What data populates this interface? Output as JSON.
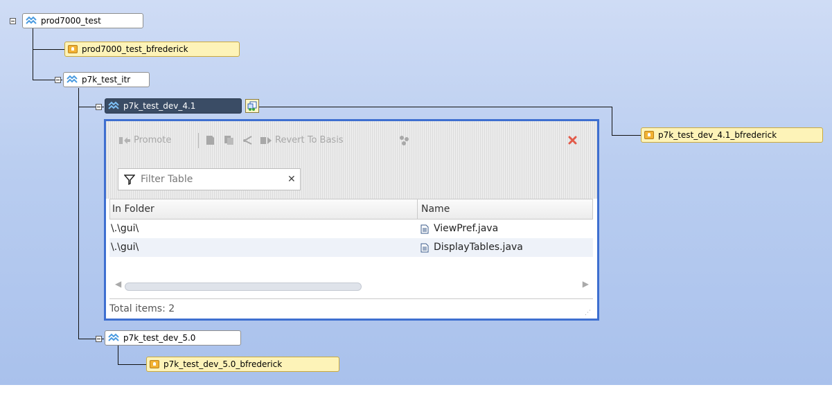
{
  "tree": {
    "root": {
      "label": "prod7000_test"
    },
    "root_workspace": {
      "label": "prod7000_test_bfrederick"
    },
    "itr": {
      "label": "p7k_test_itr"
    },
    "dev41": {
      "label": "p7k_test_dev_4.1"
    },
    "dev41_workspace": {
      "label": "p7k_test_dev_4.1_bfrederick"
    },
    "dev50": {
      "label": "p7k_test_dev_5.0"
    },
    "dev50_workspace": {
      "label": "p7k_test_dev_5.0_bfrederick"
    }
  },
  "panel": {
    "toolbar": {
      "promote_label": "Promote",
      "revert_label": "Revert To Basis"
    },
    "filter": {
      "placeholder": "Filter Table"
    },
    "table": {
      "columns": [
        "In Folder",
        "Name"
      ],
      "rows": [
        {
          "folder": "\\.\\gui\\",
          "name": "ViewPref.java"
        },
        {
          "folder": "\\.\\gui\\",
          "name": "DisplayTables.java"
        }
      ]
    },
    "status": "Total items: 2"
  },
  "colors": {
    "panel_border": "#3e6fd0",
    "selected_node": "#3a4c65",
    "workspace_node": "#fdf3b8",
    "close_icon": "#e25b4a"
  }
}
